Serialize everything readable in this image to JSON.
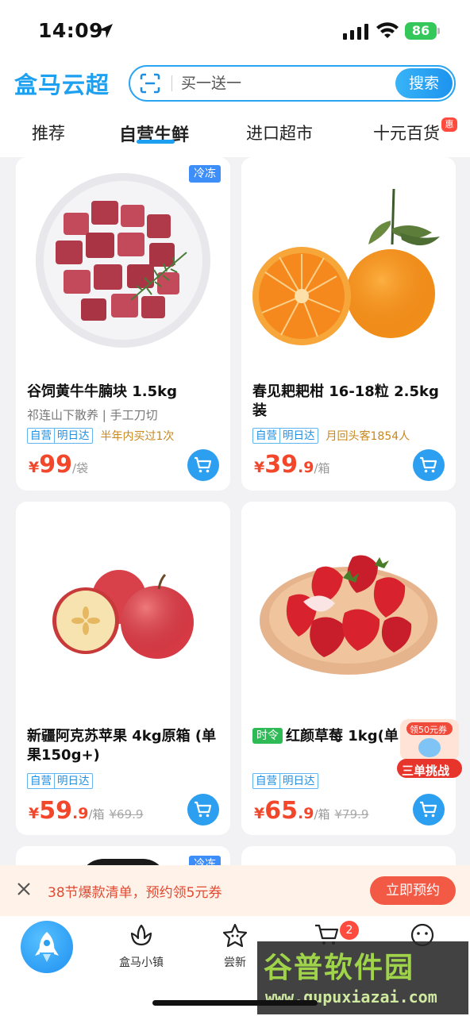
{
  "status": {
    "time": "14:09",
    "battery": "86"
  },
  "header": {
    "logo": "盒马云超",
    "search_placeholder": "买一送一",
    "search_button": "搜索"
  },
  "tabs": [
    {
      "label": "推荐",
      "active": false
    },
    {
      "label": "自营生鲜",
      "active": true
    },
    {
      "label": "进口超市",
      "active": false
    },
    {
      "label": "十元百货",
      "active": false
    }
  ],
  "tab_badge": "惠",
  "products": [
    {
      "cold_tag": "冷冻",
      "title": "谷饲黄牛牛腩块 1.5kg",
      "subtitle": "祁连山下散养 | 手工刀切",
      "tags": [
        "自营",
        "明日达"
      ],
      "note": "半年内买过1次",
      "price_symbol": "¥",
      "price_int": "99",
      "price_dec": "",
      "unit": "/袋",
      "old_price": ""
    },
    {
      "cold_tag": "",
      "title": "春见耙耙柑 16-18粒 2.5kg装",
      "subtitle": "",
      "tags": [
        "自营",
        "明日达"
      ],
      "note": "月回头客1854人",
      "price_symbol": "¥",
      "price_int": "39",
      "price_dec": ".9",
      "unit": "/箱",
      "old_price": ""
    },
    {
      "cold_tag": "",
      "title": "新疆阿克苏苹果 4kg原箱 (单果150g+)",
      "subtitle": "",
      "tags": [
        "自营",
        "明日达"
      ],
      "note": "",
      "price_symbol": "¥",
      "price_int": "59",
      "price_dec": ".9",
      "unit": "/箱",
      "old_price": "¥69.9"
    },
    {
      "cold_tag": "",
      "title_badge": "时令",
      "title": "红颜草莓 1kg(单 15g)",
      "subtitle": "",
      "tags": [
        "自营",
        "明日达"
      ],
      "note": "",
      "price_symbol": "¥",
      "price_int": "65",
      "price_dec": ".9",
      "unit": "/箱",
      "old_price": "¥79.9"
    }
  ],
  "next_card_tag": "冷冻",
  "promo_float": {
    "top": "领50元券",
    "bottom": "三单挑战"
  },
  "banner": {
    "text": "38节爆款清单，预约领5元券",
    "button": "立即预约"
  },
  "bottom_nav": [
    {
      "label": "盒马小镇",
      "icon": "tulip-icon"
    },
    {
      "label": "尝新",
      "icon": "star-face-icon"
    },
    {
      "label": "",
      "icon": "cart-icon"
    },
    {
      "label": "",
      "icon": "smile-icon"
    }
  ],
  "cart_badge": "2",
  "watermark": {
    "big": "谷普软件园",
    "small": "www.gupuxiazai.com"
  },
  "colors": {
    "brand_blue": "#1ea0f0",
    "price_red": "#f2472b",
    "banner_bg": "#fff3e9"
  }
}
